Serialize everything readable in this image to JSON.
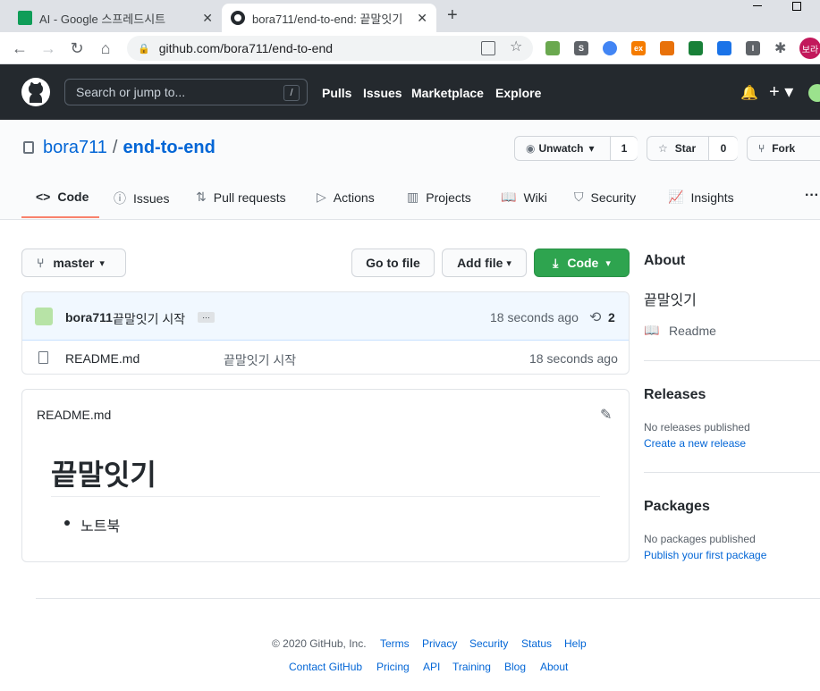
{
  "browser": {
    "tabs": [
      {
        "title": "AI - Google 스프레드시트"
      },
      {
        "title": "bora711/end-to-end: 끝말잇기"
      }
    ],
    "url": "github.com/bora711/end-to-end",
    "profile": "보라"
  },
  "github": {
    "search_placeholder": "Search or jump to...",
    "search_key": "/",
    "nav": [
      "Pulls",
      "Issues",
      "Marketplace",
      "Explore"
    ]
  },
  "repo": {
    "owner": "bora711",
    "slash": "/",
    "name": "end-to-end",
    "unwatch_label": "Unwatch",
    "watch_count": "1",
    "star_label": "Star",
    "star_count": "0",
    "fork_label": "Fork",
    "tabs": [
      "Code",
      "Issues",
      "Pull requests",
      "Actions",
      "Projects",
      "Wiki",
      "Security",
      "Insights"
    ],
    "more": "···"
  },
  "code": {
    "branch": "master",
    "goto_file": "Go to file",
    "add_file": "Add file",
    "code_btn": "Code",
    "commit_author": "bora711",
    "commit_msg": "끝말잇기 시작",
    "commit_ellipsis": "…",
    "commit_time": "18 seconds ago",
    "commit_count": "2",
    "files": [
      {
        "name": "README.md",
        "message": "끝말잇기 시작",
        "time": "18 seconds ago"
      }
    ]
  },
  "readme": {
    "filename": "README.md",
    "heading": "끝말잇기",
    "items": [
      "노트북"
    ]
  },
  "sidebar": {
    "about_title": "About",
    "about_desc": "끝말잇기",
    "readme_label": "Readme",
    "releases_title": "Releases",
    "releases_text": "No releases published",
    "releases_link": "Create a new release",
    "packages_title": "Packages",
    "packages_text": "No packages published",
    "packages_link": "Publish your first package"
  },
  "footer": {
    "copyright": "© 2020 GitHub, Inc.",
    "row1": [
      "Terms",
      "Privacy",
      "Security",
      "Status",
      "Help"
    ],
    "row2": [
      "Contact GitHub",
      "Pricing",
      "API",
      "Training",
      "Blog",
      "About"
    ]
  },
  "colors": {
    "accent": "#0366d6",
    "green": "#2ea44f",
    "header": "#24292e"
  }
}
